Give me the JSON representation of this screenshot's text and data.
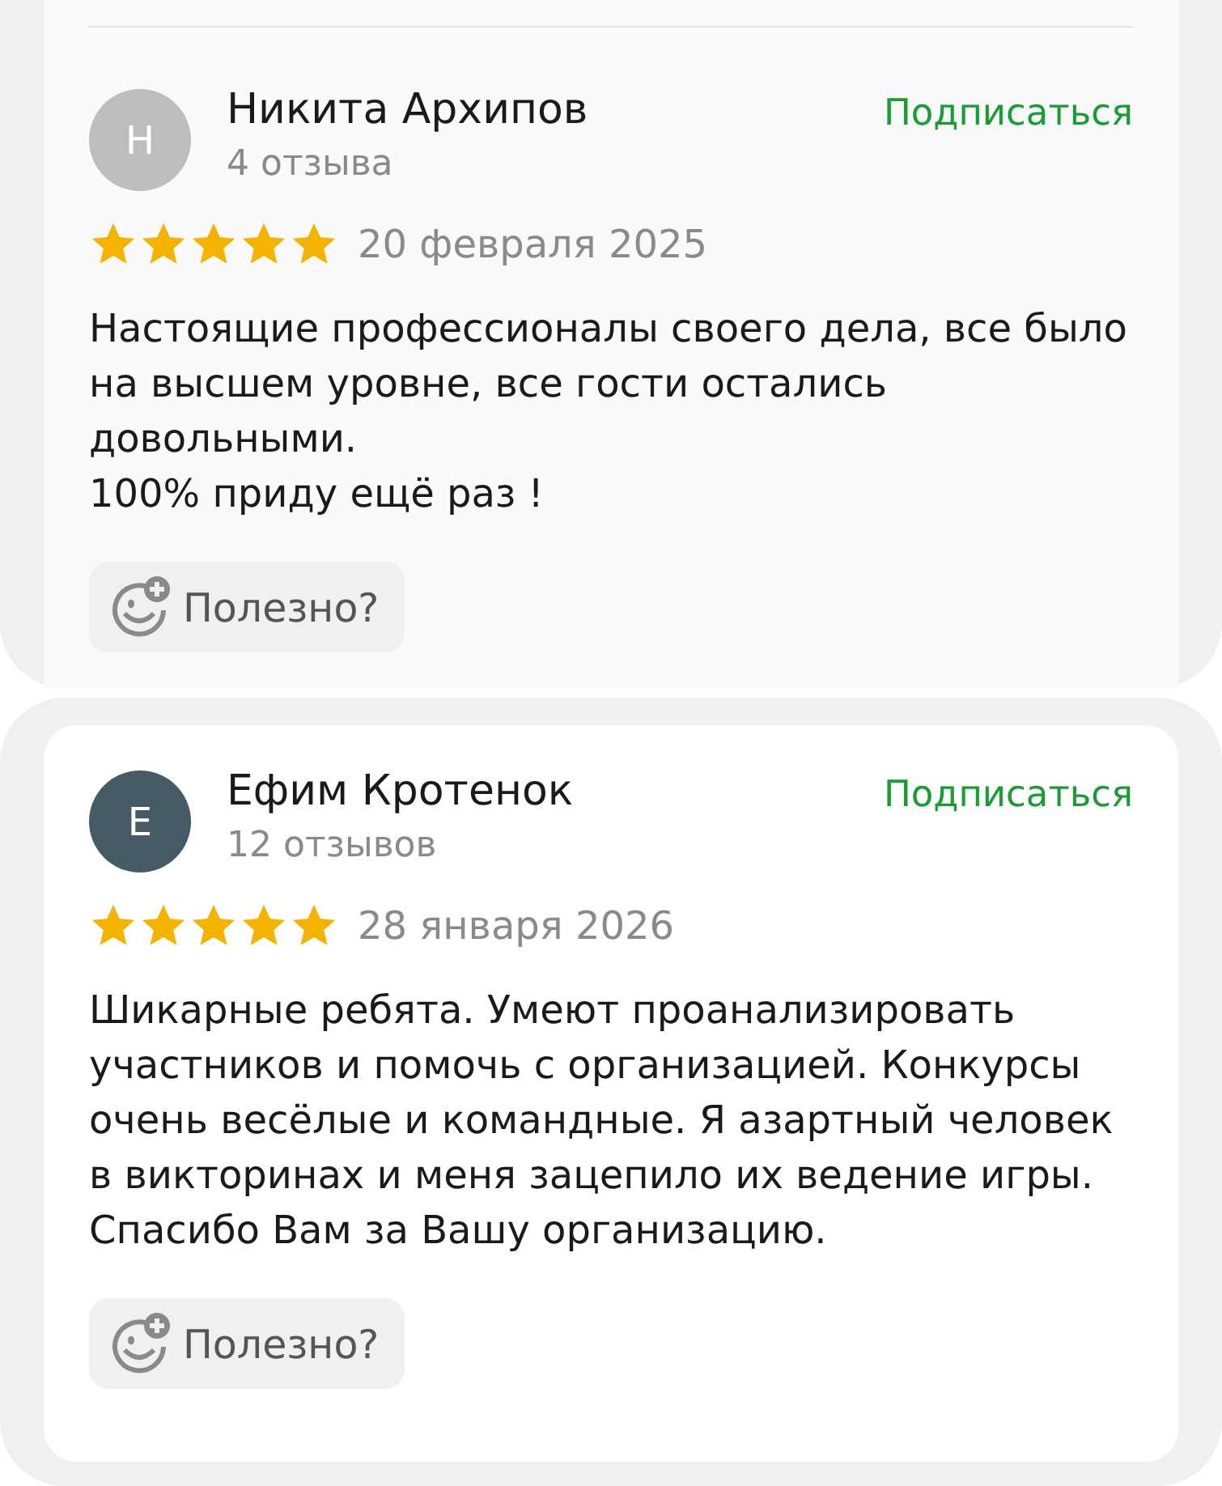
{
  "reviews": [
    {
      "author": "Никита Архипов",
      "initial": "Н",
      "color": "#bdbdbd",
      "review_count": "4 отзыва",
      "subscribe": "Подписаться",
      "stars": 5,
      "date": "20 февраля 2025",
      "text": [
        "Настоящие профессионалы своего дела, все было на высшем уровне, все гости остались довольными.",
        "100% приду ещё раз !"
      ],
      "helpful": "Полезно?"
    },
    {
      "author": "Ефим Кротенок",
      "initial": "Е",
      "color": "#455a64",
      "review_count": "12 отзывов",
      "subscribe": "Подписаться",
      "stars": 5,
      "date": "28 января 2026",
      "text": [
        "Шикарные ребята. Умеют проанализировать участников и помочь с организацией. Конкурсы очень весёлые и командные. Я азартный человек в викторинах и меня зацепило их ведение игры. Спасибо Вам за Вашу организацию."
      ],
      "helpful": "Полезно?"
    }
  ]
}
